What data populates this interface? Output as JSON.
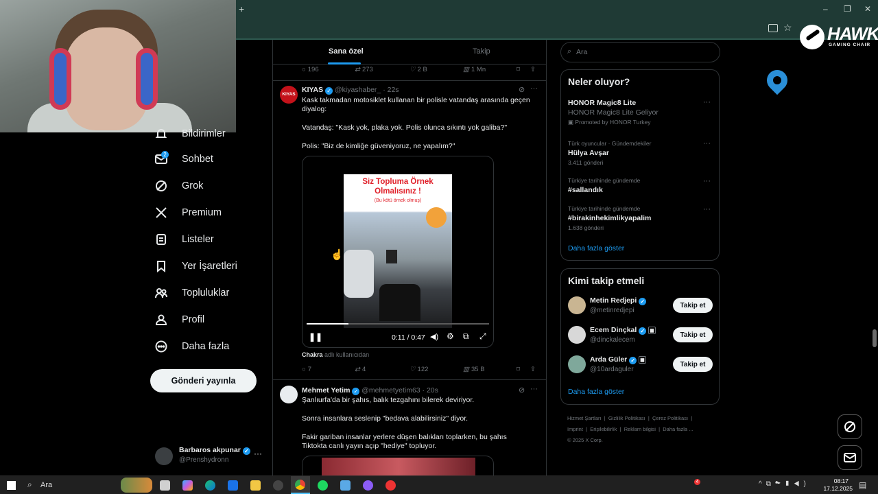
{
  "browser": {
    "new_tab": "+",
    "window_controls": {
      "minimize": "–",
      "restore": "❐",
      "close": "✕"
    }
  },
  "brand_logo": {
    "name": "HAWK",
    "sub": "GAMING CHAIR"
  },
  "sidebar": {
    "items": [
      {
        "label": "Bildirimler",
        "icon": "bell-icon"
      },
      {
        "label": "Sohbet",
        "icon": "mail-icon",
        "badge": "2"
      },
      {
        "label": "Grok",
        "icon": "grok-icon"
      },
      {
        "label": "Premium",
        "icon": "x-logo-icon"
      },
      {
        "label": "Listeler",
        "icon": "list-icon"
      },
      {
        "label": "Yer İşaretleri",
        "icon": "bookmark-icon"
      },
      {
        "label": "Topluluklar",
        "icon": "communities-icon"
      },
      {
        "label": "Profil",
        "icon": "profile-icon"
      },
      {
        "label": "Daha fazla",
        "icon": "more-circle-icon"
      }
    ],
    "post_button": "Gönderi yayınla",
    "account": {
      "name": "Barbaros akpunar",
      "handle": "@Prenshydronn",
      "more": "···"
    }
  },
  "timeline": {
    "tabs": [
      "Sana özel",
      "Takip"
    ],
    "prev_actions": {
      "replies": "196",
      "reposts": "273",
      "likes": "2 B",
      "views": "1 Mn"
    },
    "post1": {
      "avatar_text": "KIYAS",
      "name": "KIYAS",
      "handle": "@kiyashaber_",
      "time": "· 22s",
      "text1": "Kask takmadan motosiklet kullanan bir polisle vatandaş arasında geçen diyalog:",
      "text2": "Vatandaş: \"Kask yok, plaka yok. Polis olunca sıkıntı yok galiba?\"",
      "text3": "Polis: \"Biz de kimliğe güveniyoruz, ne yapalım?\"",
      "video": {
        "overlay_title": "Siz Topluma Örnek Olmalısınız !",
        "overlay_sub": "(Bu kötü örnek olmuş)",
        "time": "0:11 / 0:47",
        "progress": 0.23
      },
      "tag_user": "Chakra",
      "tag_suffix": "adlı kullanıcıdan",
      "actions": {
        "replies": "7",
        "reposts": "4",
        "likes": "122",
        "views": "35 B"
      }
    },
    "post2": {
      "name": "Mehmet Yetim",
      "handle": "@mehmetyetim63",
      "time": "· 20s",
      "text1": "Şanlıurfa'da bir şahıs, balık tezgahını bilerek deviriyor.",
      "text2": "Sonra insanlara seslenip \"bedava alabilirsiniz\" diyor.",
      "text3": "Fakir gariban insanlar yerlere düşen balıkları toplarken, bu şahıs Tiktokta canlı yayın açıp \"hediye\" topluyor."
    }
  },
  "search": {
    "placeholder": "Ara"
  },
  "trends": {
    "title": "Neler oluyor?",
    "items": [
      {
        "context": "HONOR Magic8 Lite",
        "title": "HONOR Magic8 Lite Geliyor",
        "meta": "Promoted by HONOR Turkey"
      },
      {
        "context": "Türk oyuncular · Gündemdekiler",
        "title": "Hülya Avşar",
        "meta": "3.411 gönderi"
      },
      {
        "context": "Türkiye tarihinde gündemde",
        "title": "#sallandık",
        "meta": ""
      },
      {
        "context": "Türkiye tarihinde gündemde",
        "title": "#birakinhekimlikyapalim",
        "meta": "1.638 gönderi"
      }
    ],
    "more": "Daha fazla göster"
  },
  "who_to_follow": {
    "title": "Kimi takip etmeli",
    "users": [
      {
        "name": "Metin Redjepi",
        "handle": "@metinredjepi",
        "button": "Takip et"
      },
      {
        "name": "Ecem Dinçkal",
        "handle": "@dinckalecem",
        "button": "Takip et"
      },
      {
        "name": "Arda Güler",
        "handle": "@10ardaguler",
        "button": "Takip et"
      }
    ],
    "more": "Daha fazla göster"
  },
  "footer": {
    "links": [
      "Hizmet Şartları",
      "Gizlilik Politikası",
      "Çerez Politikası",
      "Imprint",
      "Erişilebilirlik",
      "Reklam bilgisi",
      "Daha fazla ..."
    ],
    "copyright": "© 2025 X Corp."
  },
  "taskbar": {
    "search": "Ara",
    "time": "08:17",
    "date": "17.12.2025",
    "notif_count": "4"
  },
  "colors": {
    "accent": "#1d9bf0",
    "bg": "#000000",
    "border": "#2f3336",
    "muted": "#71767b"
  }
}
